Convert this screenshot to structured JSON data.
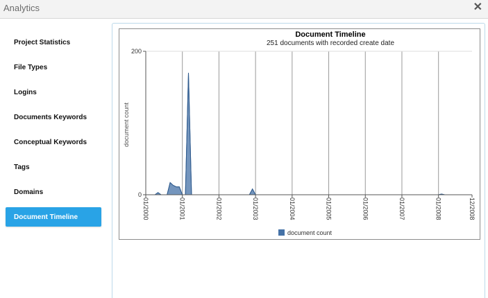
{
  "window": {
    "title": "Analytics",
    "close_glyph": "✕"
  },
  "sidebar": {
    "items": [
      {
        "label": "Project Statistics",
        "active": false
      },
      {
        "label": "File Types",
        "active": false
      },
      {
        "label": "Logins",
        "active": false
      },
      {
        "label": "Documents Keywords",
        "active": false
      },
      {
        "label": "Conceptual Keywords",
        "active": false
      },
      {
        "label": "Tags",
        "active": false
      },
      {
        "label": "Domains",
        "active": false
      },
      {
        "label": "Document Timeline",
        "active": true
      }
    ]
  },
  "chart_data": {
    "type": "area",
    "title": "Document Timeline",
    "subtitle": "251 documents with recorded create date",
    "ylabel": "document count",
    "xlabel": "",
    "ylim": [
      0,
      200
    ],
    "y_ticks": [
      "0",
      "200"
    ],
    "x_tick_labels": [
      "01/2000",
      "01/2001",
      "01/2002",
      "01/2003",
      "01/2004",
      "01/2005",
      "01/2006",
      "01/2007",
      "01/2008",
      "12/2008"
    ],
    "legend": "bottom-center",
    "grid": true,
    "series": [
      {
        "name": "document count",
        "color": "#4572a7",
        "points": [
          [
            "2000-01",
            0
          ],
          [
            "2000-02",
            0
          ],
          [
            "2000-03",
            0
          ],
          [
            "2000-04",
            0
          ],
          [
            "2000-05",
            3
          ],
          [
            "2000-06",
            0
          ],
          [
            "2000-07",
            0
          ],
          [
            "2000-08",
            0
          ],
          [
            "2000-09",
            17
          ],
          [
            "2000-10",
            13
          ],
          [
            "2000-11",
            11
          ],
          [
            "2000-12",
            11
          ],
          [
            "2001-01",
            0
          ],
          [
            "2001-02",
            0
          ],
          [
            "2001-03",
            170
          ],
          [
            "2001-04",
            0
          ],
          [
            "2001-05",
            0
          ],
          [
            "2001-06",
            0
          ],
          [
            "2001-07",
            0
          ],
          [
            "2001-08",
            0
          ],
          [
            "2001-09",
            0
          ],
          [
            "2001-10",
            0
          ],
          [
            "2001-11",
            0
          ],
          [
            "2001-12",
            0
          ],
          [
            "2002-01",
            0
          ],
          [
            "2002-02",
            0
          ],
          [
            "2002-03",
            0
          ],
          [
            "2002-04",
            0
          ],
          [
            "2002-05",
            0
          ],
          [
            "2002-06",
            0
          ],
          [
            "2002-07",
            0
          ],
          [
            "2002-08",
            0
          ],
          [
            "2002-09",
            0
          ],
          [
            "2002-10",
            0
          ],
          [
            "2002-11",
            0
          ],
          [
            "2002-12",
            8
          ],
          [
            "2003-01",
            0
          ],
          [
            "2003-06",
            0
          ],
          [
            "2004-01",
            0
          ],
          [
            "2004-06",
            0
          ],
          [
            "2005-01",
            0
          ],
          [
            "2005-06",
            0
          ],
          [
            "2006-01",
            0
          ],
          [
            "2006-06",
            0
          ],
          [
            "2007-01",
            0
          ],
          [
            "2007-06",
            0
          ],
          [
            "2008-01",
            0
          ],
          [
            "2008-02",
            1
          ],
          [
            "2008-03",
            0
          ],
          [
            "2008-06",
            0
          ],
          [
            "2008-12",
            0
          ]
        ]
      }
    ]
  }
}
